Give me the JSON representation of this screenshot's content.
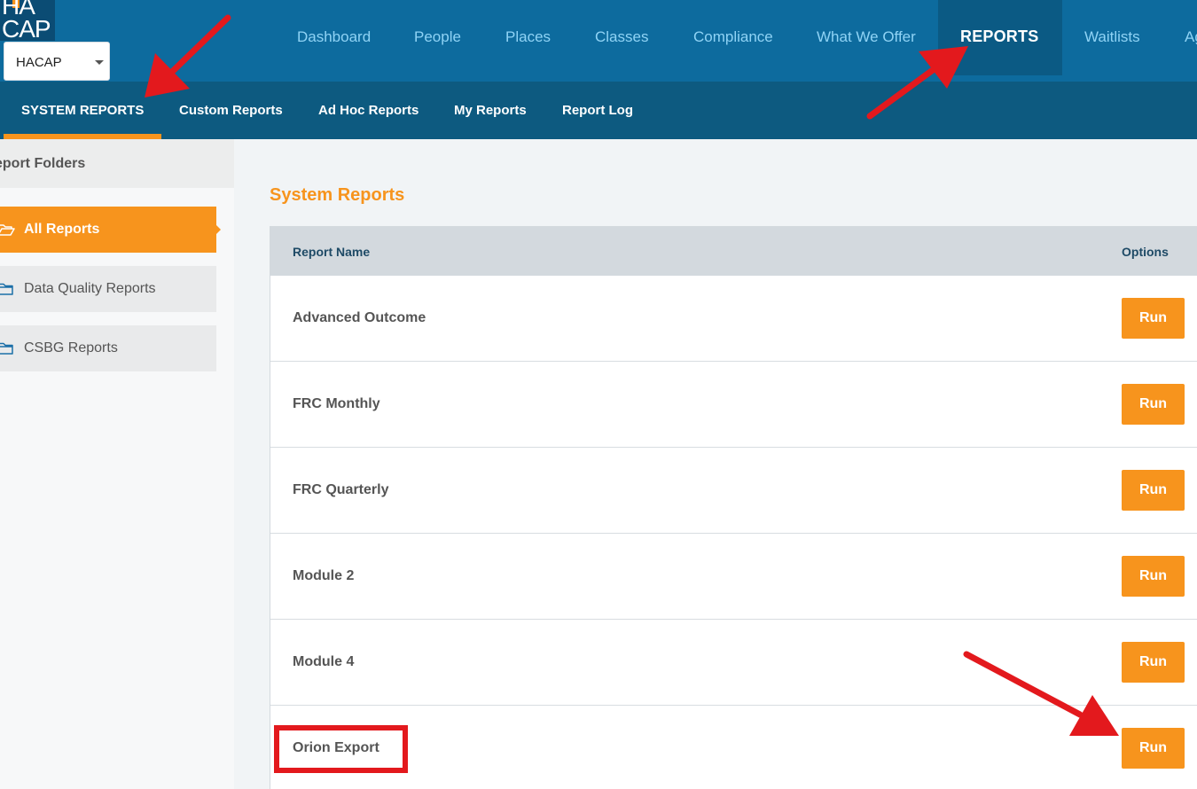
{
  "topnav": {
    "logo_text": "HACAP",
    "org_select": {
      "value": "HACAP"
    },
    "items": [
      {
        "label": "Dashboard"
      },
      {
        "label": "People"
      },
      {
        "label": "Places"
      },
      {
        "label": "Classes"
      },
      {
        "label": "Compliance"
      },
      {
        "label": "What We Offer"
      },
      {
        "label": "REPORTS",
        "active": true
      },
      {
        "label": "Waitlists"
      },
      {
        "label": "Ag"
      }
    ]
  },
  "subnav": {
    "items": [
      {
        "label": "SYSTEM REPORTS",
        "active": true
      },
      {
        "label": "Custom Reports"
      },
      {
        "label": "Ad Hoc Reports"
      },
      {
        "label": "My Reports"
      },
      {
        "label": "Report Log"
      }
    ]
  },
  "sidebar": {
    "header": "eport Folders",
    "folders": [
      {
        "label": "All Reports",
        "icon": "folder-open-icon",
        "active": true
      },
      {
        "label": "Data Quality Reports",
        "icon": "folder-icon"
      },
      {
        "label": "CSBG Reports",
        "icon": "folder-icon"
      }
    ]
  },
  "main": {
    "title": "System Reports",
    "columns": {
      "name": "Report Name",
      "options": "Options"
    },
    "rows": [
      {
        "name": "Advanced Outcome",
        "action": "Run"
      },
      {
        "name": "FRC Monthly",
        "action": "Run"
      },
      {
        "name": "FRC Quarterly",
        "action": "Run"
      },
      {
        "name": "Module 2",
        "action": "Run"
      },
      {
        "name": "Module 4",
        "action": "Run"
      },
      {
        "name": "Orion Export",
        "action": "Run"
      }
    ]
  },
  "colors": {
    "topbar": "#0d6b9e",
    "subbar": "#0d5a80",
    "accent": "#f7941d",
    "annotation": "#e3191d"
  }
}
